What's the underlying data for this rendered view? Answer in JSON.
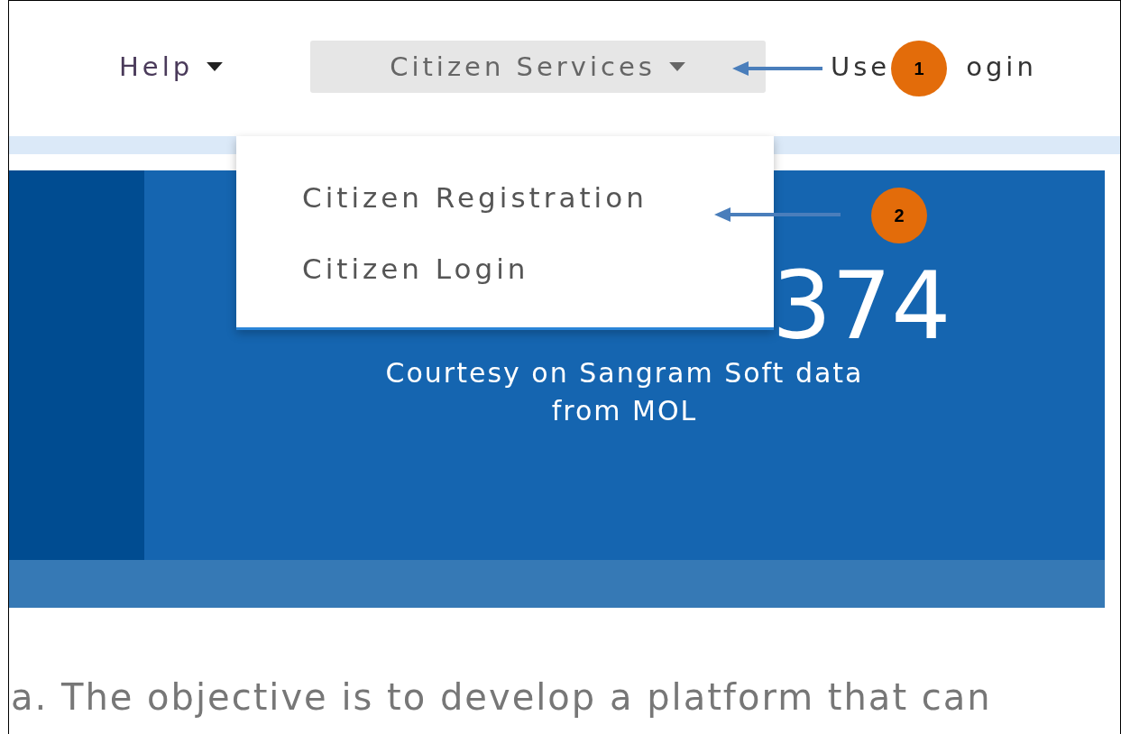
{
  "nav": [
    {
      "label": "Help",
      "kind": "dropdown",
      "selected": false
    },
    {
      "label": "Citizen Services",
      "kind": "dropdown",
      "selected": true
    },
    {
      "label_parts": [
        "Use",
        "ogin"
      ],
      "kind": "link",
      "selected": false
    }
  ],
  "dropdown_menu": {
    "items": [
      "Citizen Registration",
      "Citizen Login"
    ]
  },
  "stats_banner": {
    "number": "374",
    "caption": "Courtesy on Sangram Soft data from MOL"
  },
  "intro_text": "a. The objective is to develop a platform that can",
  "callouts": [
    {
      "label": "1"
    },
    {
      "label": "2"
    }
  ]
}
